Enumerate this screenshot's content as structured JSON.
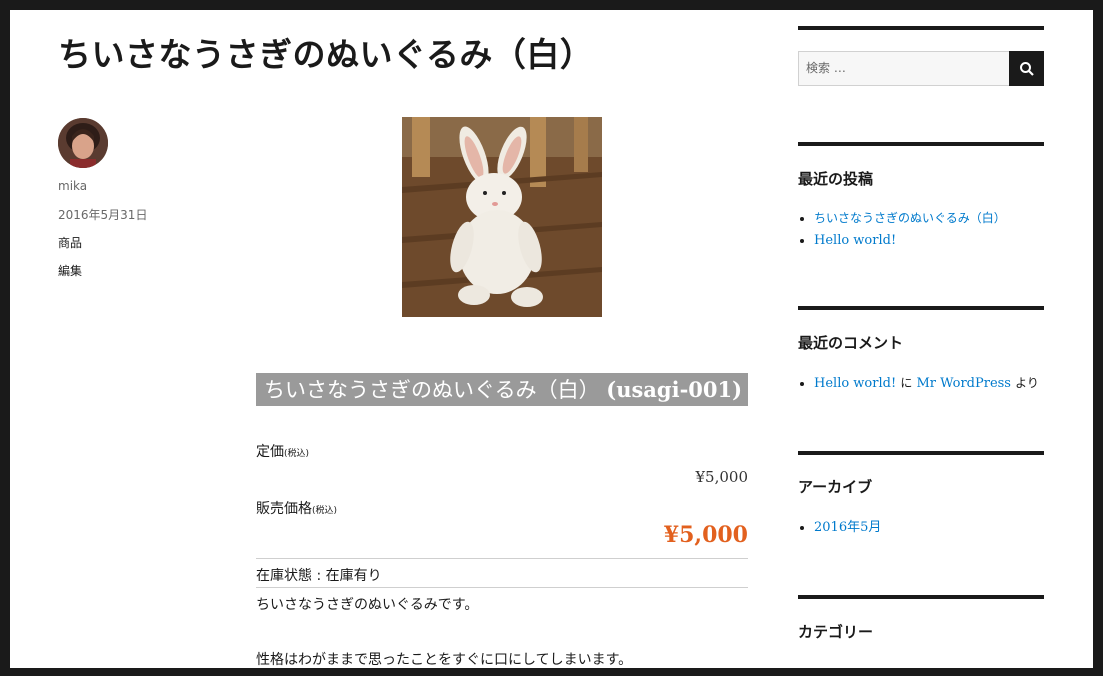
{
  "post": {
    "title": "ちいさなうさぎのぬいぐるみ（白）",
    "author": "mika",
    "date": "2016年5月31日",
    "category": "商品",
    "edit": "編集"
  },
  "product": {
    "name": "ちいさなうさぎのぬいぐるみ（白）",
    "code": "(usagi-001)",
    "list_price_label": "定価",
    "list_price_tax": "(税込)",
    "list_price": "¥5,000",
    "sale_price_label": "販売価格",
    "sale_price_tax": "(税込)",
    "sale_price": "¥5,000",
    "stock": "在庫状態 : 在庫有り",
    "description_1": "ちいさなうさぎのぬいぐるみです。",
    "description_2": "性格はわがままで思ったことをすぐに口にしてしまいます。"
  },
  "sidebar": {
    "search_placeholder": "検索 …",
    "recent_posts_title": "最近の投稿",
    "recent_posts": [
      "ちいさなうさぎのぬいぐるみ（白）",
      "Hello world!"
    ],
    "recent_comments_title": "最近のコメント",
    "comment": {
      "post": "Hello world!",
      "on": "に",
      "author": "Mr WordPress",
      "by": "より"
    },
    "archives_title": "アーカイブ",
    "archives": [
      "2016年5月"
    ],
    "categories_title": "カテゴリー"
  },
  "colors": {
    "accent": "#e2601e",
    "link": "#007acc",
    "heading_bg": "#9a9a9a"
  }
}
